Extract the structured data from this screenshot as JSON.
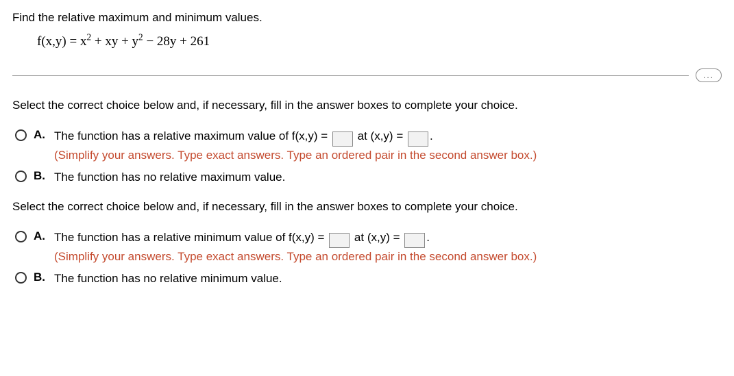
{
  "prompt": "Find the relative maximum and minimum values.",
  "formula_html": "f(x,y) = x<sup>2</sup> + xy + y<sup>2</sup> − 28y + 261",
  "more_btn": "...",
  "q1": {
    "instruction": "Select the correct choice below and, if necessary, fill in the answer boxes to complete your choice.",
    "A": {
      "label": "A.",
      "before": "The function has a relative maximum value of f(x,y) = ",
      "mid": " at (x,y) = ",
      "after": ".",
      "note": "(Simplify your answers. Type exact answers. Type an ordered pair in the second answer box.)"
    },
    "B": {
      "label": "B.",
      "text": "The function has no relative maximum value."
    }
  },
  "q2": {
    "instruction": "Select the correct choice below and, if necessary, fill in the answer boxes to complete your choice.",
    "A": {
      "label": "A.",
      "before": "The function has a relative minimum value of f(x,y) = ",
      "mid": " at (x,y) = ",
      "after": ".",
      "note": "(Simplify your answers. Type exact answers. Type an ordered pair in the second answer box.)"
    },
    "B": {
      "label": "B.",
      "text": "The function has no relative minimum value."
    }
  }
}
